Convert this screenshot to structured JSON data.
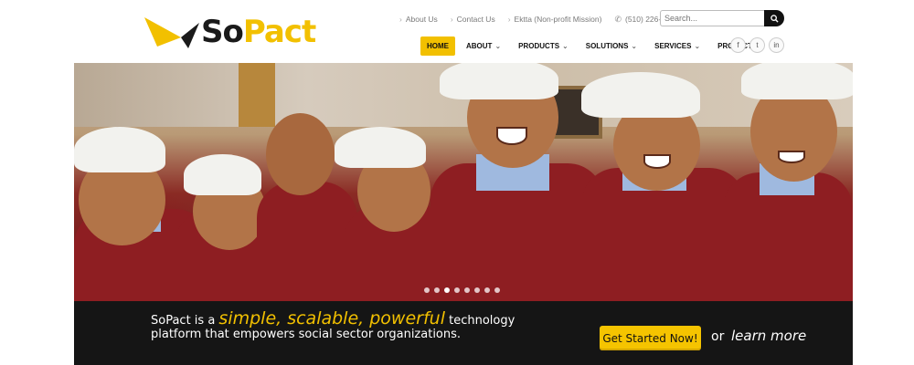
{
  "brand": {
    "part1": "So",
    "part2": "Pact",
    "logo_colors": {
      "black": "#1a1a1a",
      "yellow": "#f2c000"
    }
  },
  "top_links": [
    {
      "label": "About Us"
    },
    {
      "label": "Contact Us"
    },
    {
      "label": "Ektta (Non-profit Mission)"
    }
  ],
  "phone": {
    "number": "(510) 226-8535",
    "icon": "phone-icon"
  },
  "search": {
    "placeholder": "Search...",
    "icon": "search-icon"
  },
  "nav": [
    {
      "label": "HOME",
      "active": true,
      "dropdown": false
    },
    {
      "label": "ABOUT",
      "active": false,
      "dropdown": true
    },
    {
      "label": "PRODUCTS",
      "active": false,
      "dropdown": true
    },
    {
      "label": "SOLUTIONS",
      "active": false,
      "dropdown": true
    },
    {
      "label": "SERVICES",
      "active": false,
      "dropdown": true
    },
    {
      "label": "PROJECTS",
      "active": false,
      "dropdown": false
    }
  ],
  "social": [
    {
      "icon": "facebook-icon",
      "glyph": "f"
    },
    {
      "icon": "twitter-icon",
      "glyph": "t"
    },
    {
      "icon": "linkedin-icon",
      "glyph": "in"
    }
  ],
  "slider": {
    "slide_count": 8,
    "active_index": 2
  },
  "banner": {
    "tagline_prefix": "SoPact is a ",
    "tagline_highlight": "simple, scalable, powerful",
    "tagline_suffix": " technology platform that empowers social sector organizations.",
    "cta_label": "Get Started Now!",
    "or_text": "or",
    "learn_more": "learn more"
  },
  "colors": {
    "accent": "#f2c000",
    "banner_bg": "#151515"
  }
}
